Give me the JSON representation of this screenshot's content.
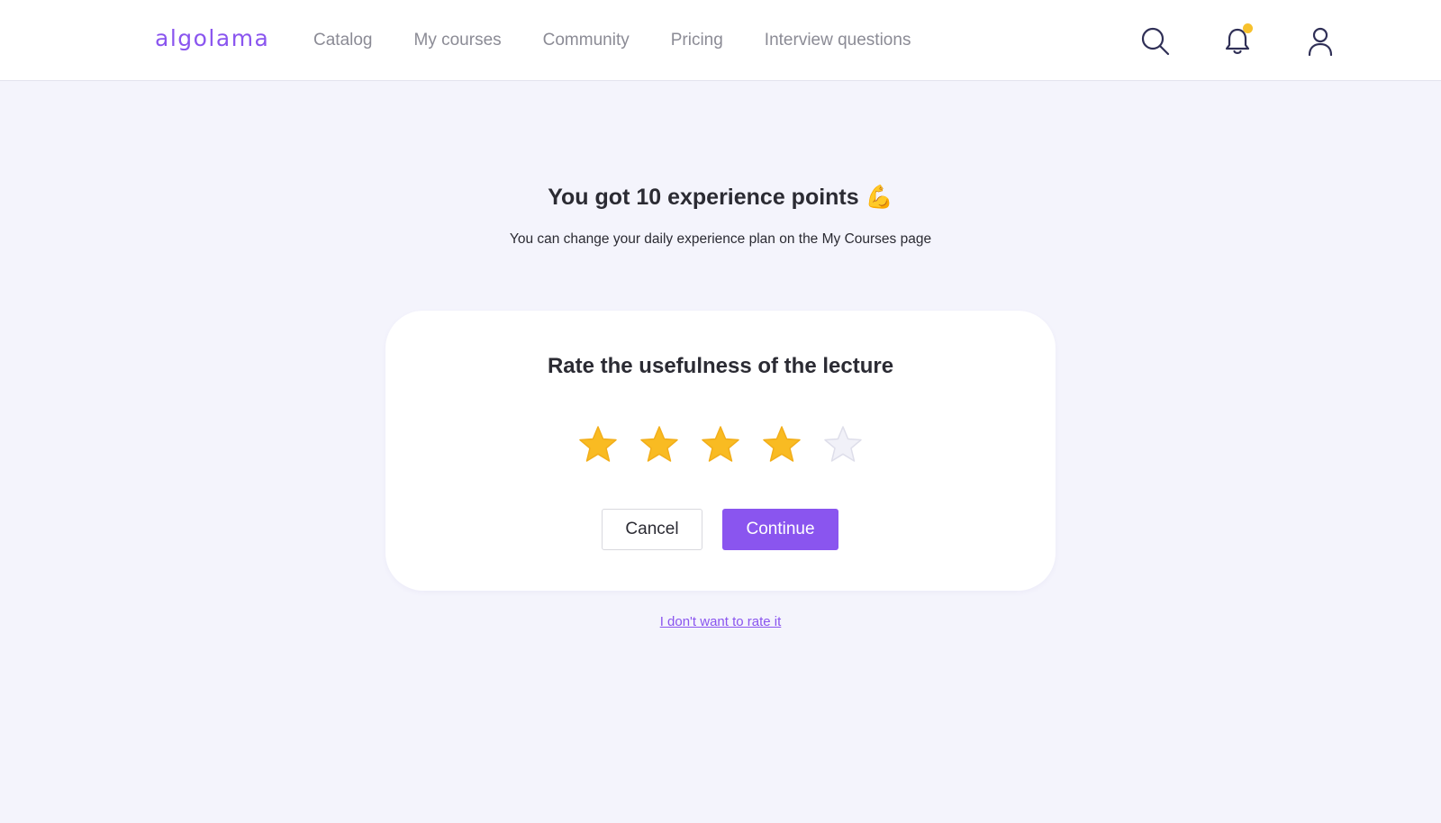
{
  "header": {
    "logo": "algolama",
    "nav": [
      "Catalog",
      "My courses",
      "Community",
      "Pricing",
      "Interview questions"
    ],
    "icons": [
      "search-icon",
      "bell-icon",
      "user-icon"
    ],
    "has_notification": true
  },
  "result": {
    "title": "You got 10 experience points",
    "emoji": "💪",
    "subtitle": "You can change your daily experience plan on the My Courses page"
  },
  "rating_card": {
    "title": "Rate the usefulness of the lecture",
    "rating": 4,
    "max_rating": 5,
    "cancel_label": "Cancel",
    "continue_label": "Continue"
  },
  "skip_link": "I don't want to rate it",
  "colors": {
    "accent": "#8a55ef",
    "star_filled": "#f9bb22",
    "star_empty": "#f1f1f8",
    "notification_dot": "#f7c12c",
    "background": "#f4f4fc"
  }
}
